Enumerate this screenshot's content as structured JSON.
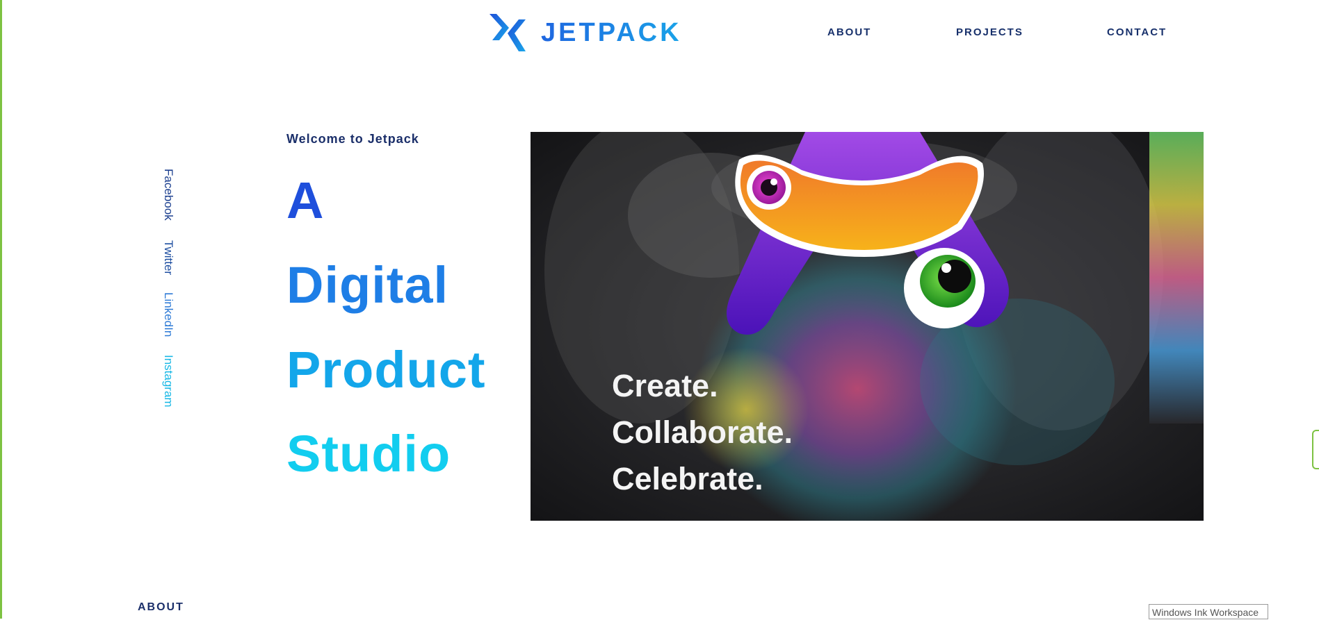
{
  "brand": {
    "name": "JETPACK",
    "logo_icon": "jetpack-chevrons-logo"
  },
  "nav": {
    "about": "ABOUT",
    "projects": "PROJECTS",
    "contact": "CONTACT"
  },
  "social": {
    "facebook": "Facebook",
    "twitter": "Twitter",
    "linkedin": "LinkedIn",
    "instagram": "Instagram"
  },
  "hero": {
    "welcome": "Welcome to Jetpack",
    "lines": [
      "A",
      "Digital",
      "Product",
      "Studio"
    ],
    "image": {
      "mascot": "purple-a-mascot-with-orange-hat",
      "taglines": [
        "Create.",
        "Collaborate.",
        "Celebrate."
      ]
    }
  },
  "footer": {
    "section_heading": "ABOUT"
  },
  "system": {
    "ink_workspace": "Windows Ink Workspace"
  },
  "colors": {
    "accent_dark": "#1f4fdc",
    "accent_mid": "#1e7ee6",
    "accent_light": "#12cdef",
    "nav_text": "#17306b",
    "edge_green": "#7dc242"
  }
}
